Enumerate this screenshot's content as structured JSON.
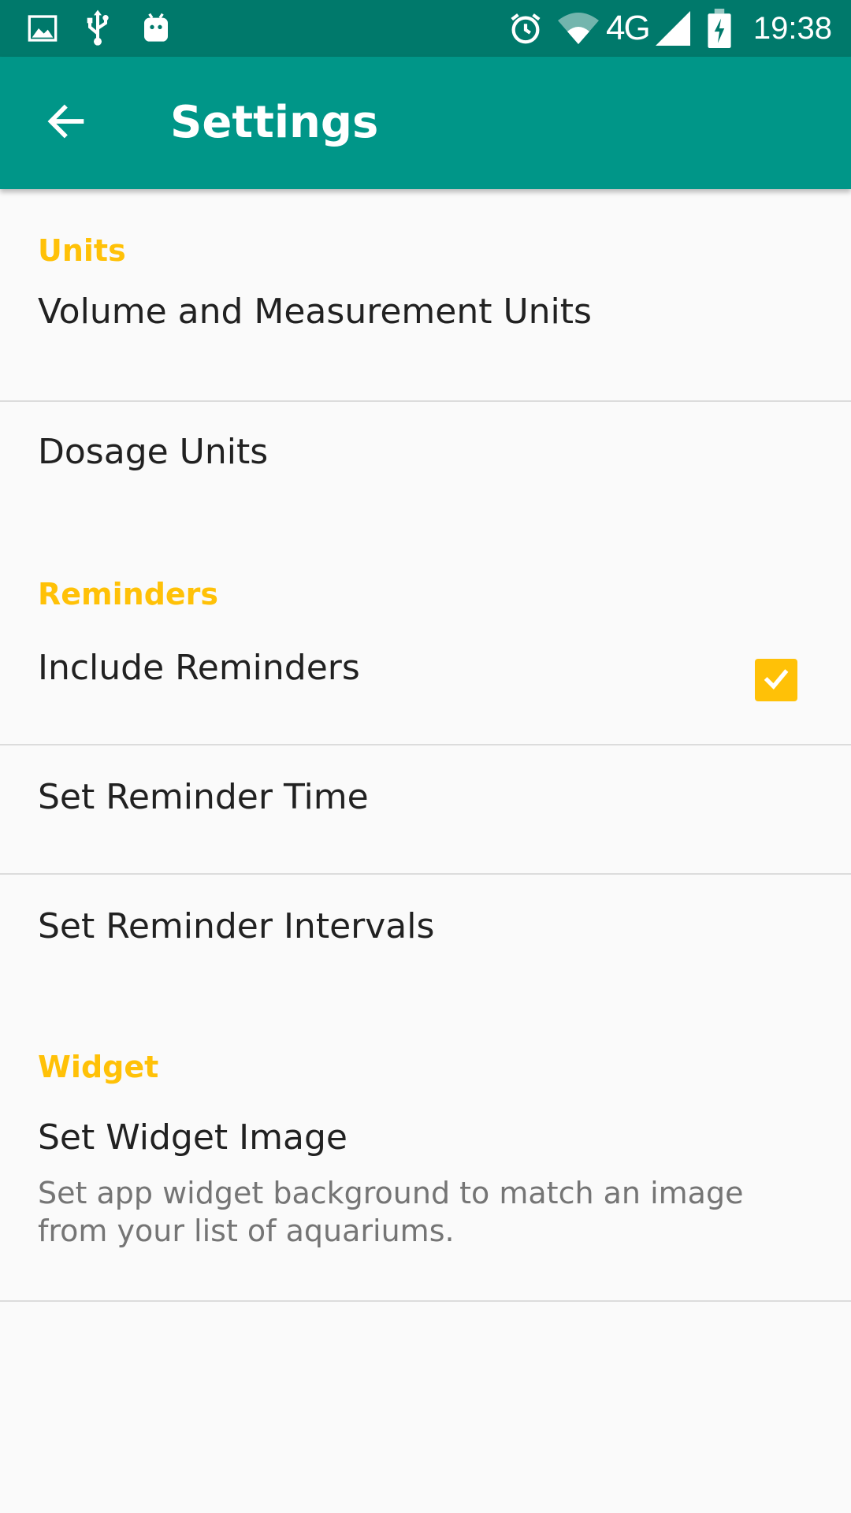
{
  "status_bar": {
    "time": "19:38",
    "network": "4G",
    "icons": [
      "image-icon",
      "usb-icon",
      "android-icon",
      "alarm-icon",
      "wifi-icon",
      "signal-icon",
      "battery-charging-icon"
    ]
  },
  "toolbar": {
    "back_icon": "arrow-back-icon",
    "title": "Settings"
  },
  "sections": {
    "units": {
      "header": "Units",
      "volume_units": "Volume and Measurement Units",
      "dosage_units": "Dosage Units"
    },
    "reminders": {
      "header": "Reminders",
      "include_reminders": "Include Reminders",
      "include_reminders_checked": true,
      "reminder_time": "Set Reminder Time",
      "reminder_intervals": "Set Reminder Intervals"
    },
    "widget": {
      "header": "Widget",
      "widget_image_title": "Set Widget Image",
      "widget_image_summary": "Set app widget background to match an image from your list of aquariums."
    }
  },
  "colors": {
    "status_bar": "#00796b",
    "toolbar": "#009688",
    "accent": "#ffc107",
    "background": "#fafafa"
  }
}
